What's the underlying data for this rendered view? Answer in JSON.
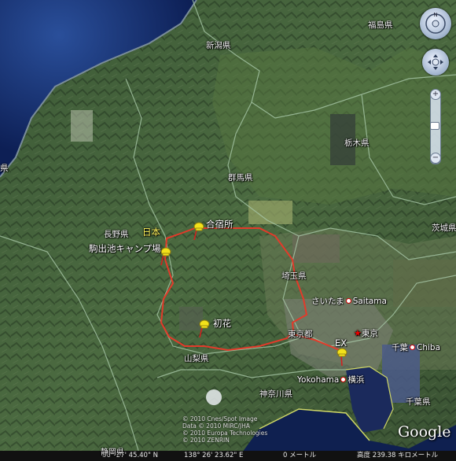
{
  "map": {
    "labels": {
      "fukushima": "福島県",
      "niigata": "新潟県",
      "tochigi": "栃木県",
      "gunma": "群馬県",
      "ibaraki": "茨城県",
      "nagano": "長野県",
      "nihon": "日本",
      "gassyukujo": "合宿所",
      "komadeike": "駒出池キャンプ場",
      "saitama_pref": "埼玉県",
      "saitama_city": "さいたま",
      "saitama_en": "Saitama",
      "hatsuhana": "初花",
      "yamanashi": "山梨県",
      "tokyo_to": "東京都",
      "ex": "EX",
      "tokyo": "東京",
      "chiba_pref_kanji": "千葉",
      "chiba_en": "Chiba",
      "yokohama_en": "Yokohama",
      "yokohama": "横浜",
      "kanagawa": "神奈川県",
      "chiba_pref": "千葉県",
      "shizuoka": "静岡県",
      "left_edge": "県"
    },
    "colors": {
      "route": "#e33a2a",
      "pin_yellow": "#f2e21a",
      "pin_red": "#d81c1c"
    }
  },
  "copyright": {
    "line1": "© 2010 Cnes/Spot Image",
    "line2": "Data © 2010 MIRC/JHA",
    "line3": "© 2010 Europa Technologies",
    "line4": "© 2010 ZENRIN"
  },
  "logo": "Google",
  "status_bar": {
    "lat": "36° 27' 45.40\" N",
    "lon": "138° 26' 23.62\" E",
    "elev": "0 メートル",
    "altitude": "高度  239.38 キロメートル"
  },
  "icons": {
    "look": "compass-look-icon",
    "move": "move-joystick-icon",
    "zoom_in": "plus-icon",
    "zoom_out": "minus-icon"
  }
}
